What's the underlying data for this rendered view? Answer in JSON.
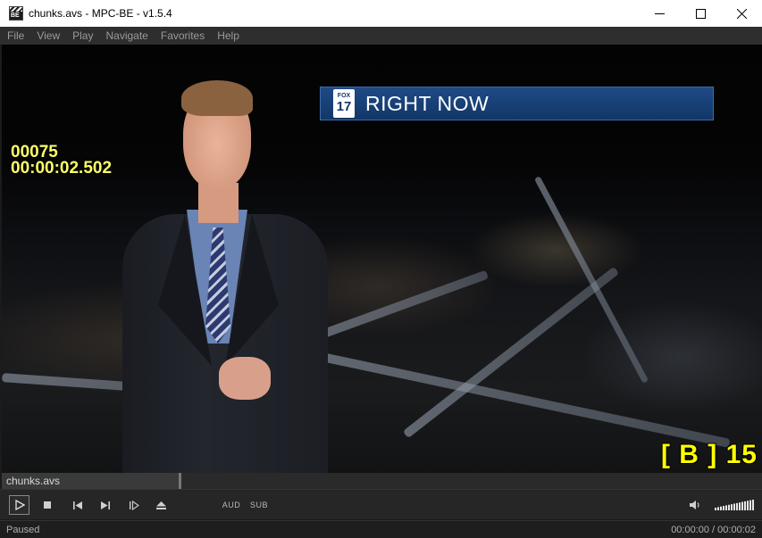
{
  "window": {
    "title": "chunks.avs - MPC-BE - v1.5.4",
    "app_icon_text": "BE"
  },
  "menu": [
    "File",
    "View",
    "Play",
    "Navigate",
    "Favorites",
    "Help"
  ],
  "video": {
    "banner": {
      "logo_top": "FOX",
      "logo_number": "17",
      "text": "RIGHT NOW"
    },
    "overlay_frame_number": "00075",
    "overlay_timecode": "00:00:02.502",
    "overlay_frame_type": "[ B ] 15"
  },
  "seekbar": {
    "file_label": "chunks.avs",
    "position_fraction": 0.236
  },
  "toolbar": {
    "audio_label": "AUD",
    "subtitle_label": "SUB",
    "volume_fraction": 1.0
  },
  "status": {
    "state": "Paused",
    "time": "00:00:00 / 00:00:02"
  },
  "icons": {
    "play": "play-icon",
    "stop": "stop-icon",
    "previous": "skip-previous-icon",
    "next": "skip-next-icon",
    "frame_step": "frame-step-icon",
    "eject": "eject-icon",
    "volume": "speaker-icon"
  }
}
